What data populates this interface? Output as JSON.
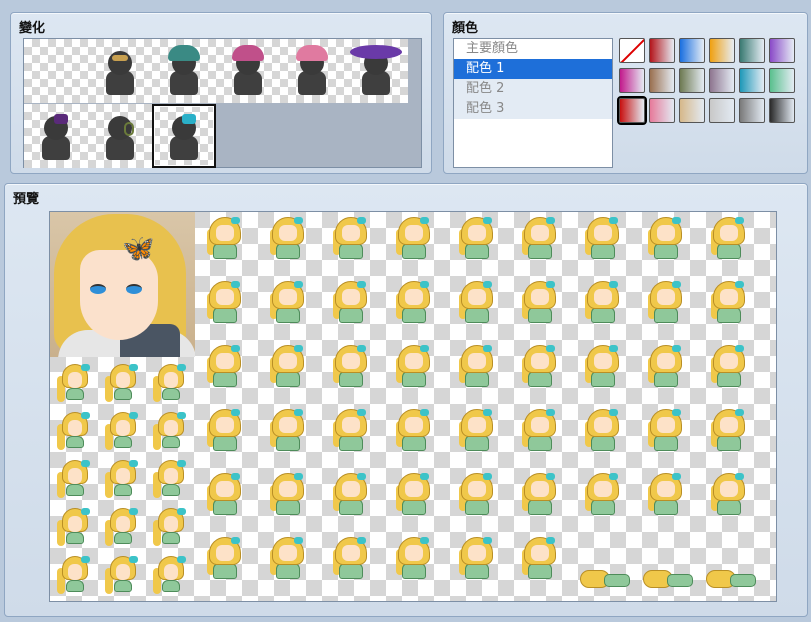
{
  "variation": {
    "title": "變化",
    "items": [
      {
        "name": "none",
        "selected": false
      },
      {
        "name": "bird-mask",
        "selected": false
      },
      {
        "name": "witch-hat-teal",
        "selected": false
      },
      {
        "name": "bandana-pink",
        "selected": false
      },
      {
        "name": "flower-hat-pink",
        "selected": false
      },
      {
        "name": "wide-hat-purple",
        "selected": false
      },
      {
        "name": "ribbon-purple",
        "selected": false
      },
      {
        "name": "headset",
        "selected": false
      },
      {
        "name": "butterfly-clip",
        "selected": true
      }
    ]
  },
  "color": {
    "title": "顏色",
    "list": [
      "主要顏色",
      "配色 1",
      "配色 2",
      "配色 3"
    ],
    "active_index": 1,
    "swatches": [
      {
        "name": "none",
        "color": "#ffffff"
      },
      {
        "name": "red",
        "color": "#b4151b"
      },
      {
        "name": "blue",
        "color": "#1a6fe0"
      },
      {
        "name": "orange",
        "color": "#f0a010"
      },
      {
        "name": "teal",
        "color": "#3a7a72"
      },
      {
        "name": "purple",
        "color": "#8a4ac8"
      },
      {
        "name": "magenta",
        "color": "#c21a8c"
      },
      {
        "name": "brown",
        "color": "#9a7050"
      },
      {
        "name": "olive",
        "color": "#6e7a52"
      },
      {
        "name": "mauve",
        "color": "#8e7690"
      },
      {
        "name": "cyan",
        "color": "#1e98b8"
      },
      {
        "name": "mint",
        "color": "#5ac08e"
      },
      {
        "name": "crimson-current",
        "color": "#c81010"
      },
      {
        "name": "pink",
        "color": "#e67a9a"
      },
      {
        "name": "tan",
        "color": "#d6b88a"
      },
      {
        "name": "silver",
        "color": "#c8c8c8"
      },
      {
        "name": "gray",
        "color": "#7a7a7a"
      },
      {
        "name": "charcoal",
        "color": "#2a2a2a"
      }
    ]
  },
  "preview": {
    "title": "預覽"
  }
}
